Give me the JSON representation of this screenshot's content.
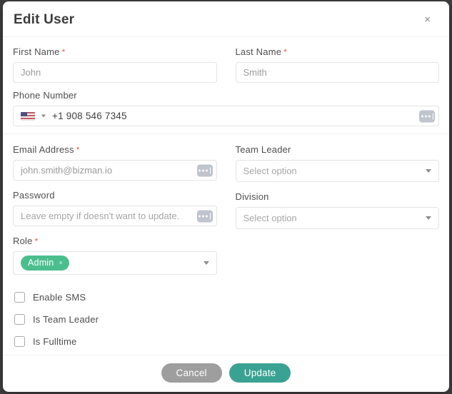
{
  "modal": {
    "title": "Edit User",
    "close_glyph": "×"
  },
  "form": {
    "first_name": {
      "label": "First Name",
      "required_mark": "*",
      "value": "John"
    },
    "last_name": {
      "label": "Last Name",
      "required_mark": "*",
      "value": "Smith"
    },
    "phone": {
      "label": "Phone Number",
      "value": "+1 908 546 7345",
      "country": "US"
    },
    "email": {
      "label": "Email Address",
      "required_mark": "*",
      "value": "john.smith@bizman.io"
    },
    "team_leader": {
      "label": "Team Leader",
      "placeholder": "Select option"
    },
    "password": {
      "label": "Password",
      "placeholder": "Leave empty if doesn't want to update."
    },
    "division": {
      "label": "Division",
      "placeholder": "Select option"
    },
    "role": {
      "label": "Role",
      "required_mark": "*",
      "selected_tag": "Admin",
      "tag_remove_glyph": "×"
    }
  },
  "checkboxes": [
    {
      "label": "Enable SMS",
      "checked": false
    },
    {
      "label": "Is Team Leader",
      "checked": false
    },
    {
      "label": "Is Fulltime",
      "checked": false
    }
  ],
  "footer": {
    "cancel_label": "Cancel",
    "update_label": "Update"
  },
  "colors": {
    "accent_teal": "#3AA292",
    "tag_green": "#4BBE8E",
    "required_red": "#E4604E",
    "cancel_gray": "#9E9E9E"
  }
}
